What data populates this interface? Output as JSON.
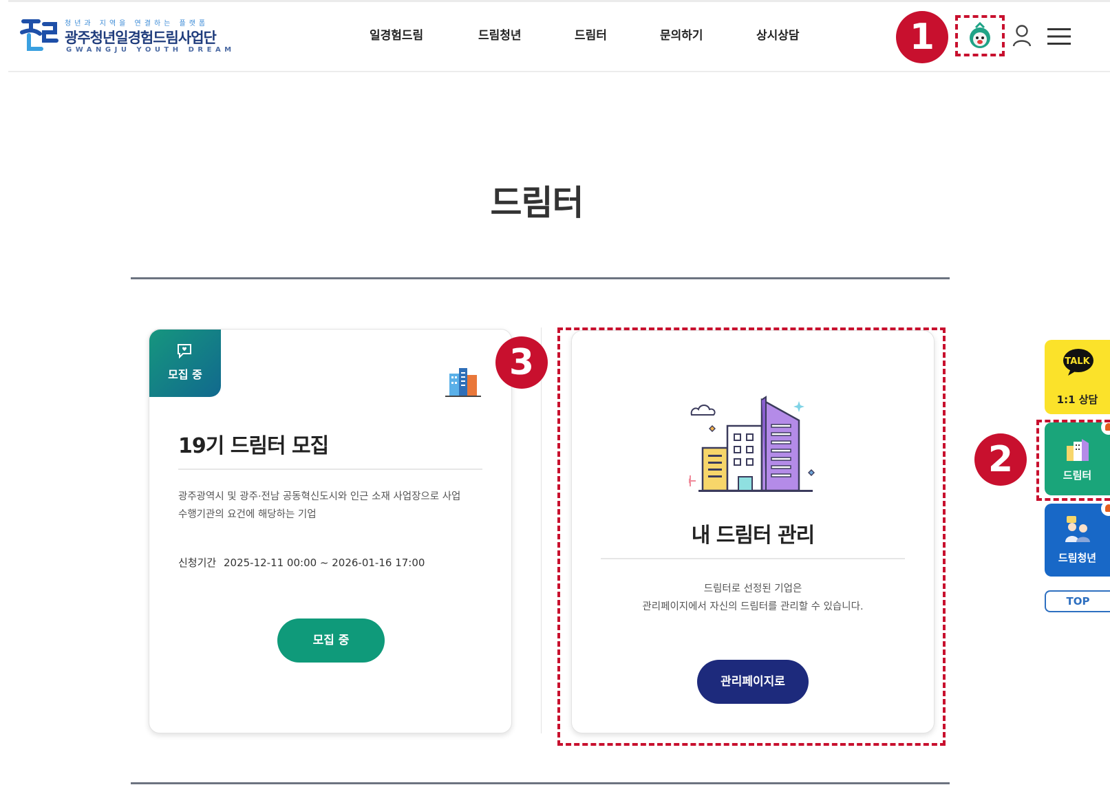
{
  "header": {
    "logo": {
      "tagline": "청년과 지역을 연결하는 플랫폼",
      "name": "광주청년일경험드림사업단",
      "english": "GWANGJU YOUTH DREAM"
    },
    "nav": [
      "일경험드림",
      "드림청년",
      "드림터",
      "문의하기",
      "상시상담"
    ],
    "icons": [
      "mascot-icon",
      "user-icon",
      "hamburger-menu-icon"
    ]
  },
  "annotations": [
    "1",
    "2",
    "3"
  ],
  "page": {
    "title": "드림터"
  },
  "card_recruit": {
    "tag": "모집 중",
    "title": "19기 드림터 모집",
    "desc_line1": "광주광역시 및 광주·전남 공동혁신도시와 인근 소재 사업장으로 사업",
    "desc_line2": "수행기관의 요건에 해당하는 기업",
    "period_label": "신청기간",
    "period_value": "2025-12-11 00:00 ~ 2026-01-16 17:00",
    "button": "모집 중",
    "colors": {
      "button": "#0f9a7a"
    }
  },
  "card_manage": {
    "title": "내 드림터 관리",
    "desc_line1": "드림터로 선정된 기업은",
    "desc_line2": "관리페이지에서 자신의 드림터를 관리할 수 있습니다.",
    "button": "관리페이지로",
    "colors": {
      "button": "#1d2a7c"
    }
  },
  "side": {
    "talk_icon_text": "TALK",
    "talk_label": "1:1 상담",
    "dreamter_label": "드림터",
    "youth_label": "드림청년",
    "top_label": "TOP",
    "colors": {
      "talk": "#fbe22a",
      "dreamter": "#1aa57a",
      "youth": "#1868c7"
    }
  },
  "colors": {
    "annotation": "#c8102e"
  }
}
